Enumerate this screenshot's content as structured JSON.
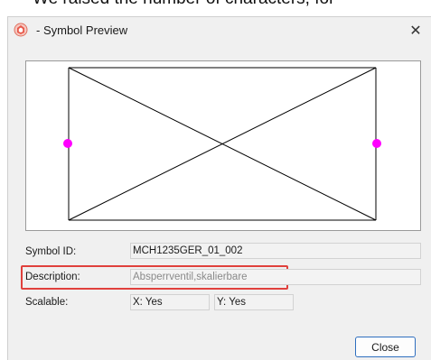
{
  "background_text": "We raised the number of characters, for",
  "window": {
    "title": "- Symbol Preview",
    "close_glyph": "✕",
    "icon": "app-logo-icon"
  },
  "form": {
    "symbol_id": {
      "label": "Symbol ID:",
      "value": "MCH1235GER_01_002"
    },
    "description": {
      "label": "Description:",
      "value": "Absperrventil,skalierbare"
    },
    "scalable": {
      "label": "Scalable:",
      "x_value": "X: Yes",
      "y_value": "Y: Yes"
    }
  },
  "buttons": {
    "close_label": "Close"
  },
  "colors": {
    "connection_point": "#ff00ff",
    "highlight_border": "#e0403c",
    "button_border": "#2f6fbf"
  }
}
